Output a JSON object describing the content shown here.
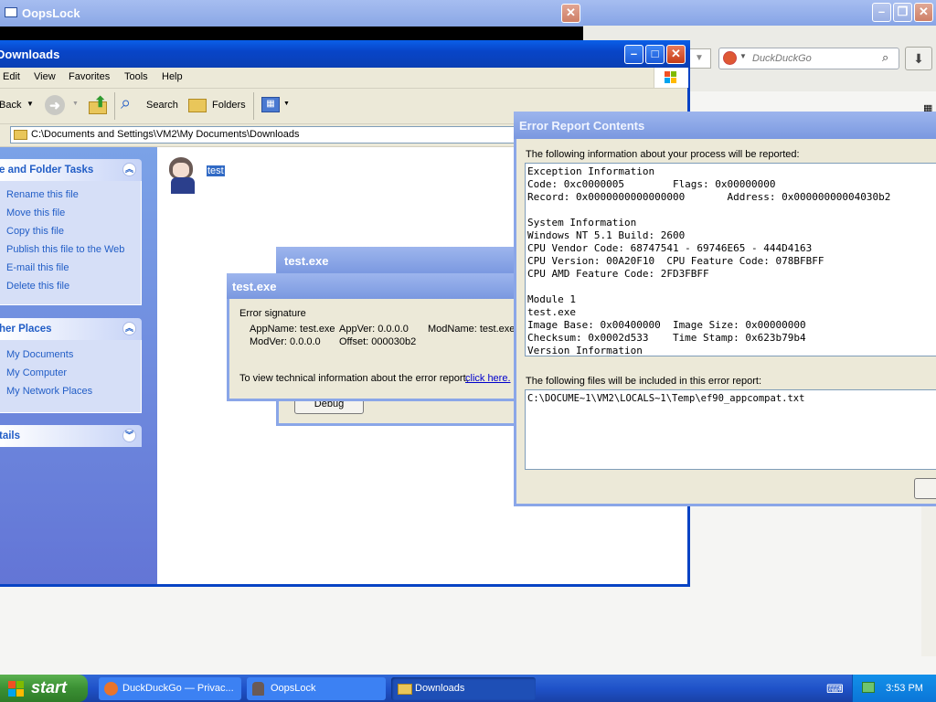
{
  "firefox": {
    "search_placeholder": "DuckDuckGo"
  },
  "oopslock": {
    "title": "OopsLock"
  },
  "explorer": {
    "title": "Downloads",
    "menu": [
      "Edit",
      "View",
      "Favorites",
      "Tools",
      "Help"
    ],
    "toolbar": {
      "back": "Back",
      "search": "Search",
      "folders": "Folders"
    },
    "address": "C:\\Documents and Settings\\VM2\\My Documents\\Downloads",
    "file_folder_tasks": {
      "header": "e and Folder Tasks",
      "items": [
        "Rename this file",
        "Move this file",
        "Copy this file",
        "Publish this file to the Web",
        "E-mail this file",
        "Delete this file"
      ]
    },
    "other_places": {
      "header": "her Places",
      "items": [
        "My Documents",
        "My Computer",
        "My Network Places"
      ]
    },
    "details": {
      "header": "tails"
    },
    "file": {
      "name": "test"
    }
  },
  "testexe_back": {
    "title": "test.exe",
    "debug_label": "Debug"
  },
  "testexe_front": {
    "title": "test.exe",
    "group_label": "Error signature",
    "sig_line1_appname": "AppName: test.exe",
    "sig_line1_appver": "AppVer: 0.0.0.0",
    "sig_line1_modname": "ModName: test.exe",
    "sig_line2_modver": "ModVer: 0.0.0.0",
    "sig_line2_offset": "Offset: 000030b2",
    "tech_text": "To view technical information about the error report,",
    "tech_link": "click here."
  },
  "error_report": {
    "title": "Error Report Contents",
    "intro": "The following information about your process will be reported:",
    "lines": [
      "Exception Information",
      "Code: 0xc0000005        Flags: 0x00000000",
      "Record: 0x0000000000000000       Address: 0x00000000004030b2",
      "",
      "System Information",
      "Windows NT 5.1 Build: 2600",
      "CPU Vendor Code: 68747541 - 69746E65 - 444D4163",
      "CPU Version: 00A20F10  CPU Feature Code: 078BFBFF",
      "CPU AMD Feature Code: 2FD3FBFF",
      "",
      "Module 1",
      "test.exe",
      "Image Base: 0x00400000  Image Size: 0x00000000",
      "Checksum: 0x0002d533    Time Stamp: 0x623b79b4",
      "Version Information"
    ],
    "files_intro": "The following files will be included in this error report:",
    "files": "C:\\DOCUME~1\\VM2\\LOCALS~1\\Temp\\ef90_appcompat.txt"
  },
  "taskbar": {
    "start": "start",
    "items": [
      "DuckDuckGo — Privac...",
      "OopsLock",
      "Downloads"
    ],
    "clock": "3:53 PM"
  }
}
